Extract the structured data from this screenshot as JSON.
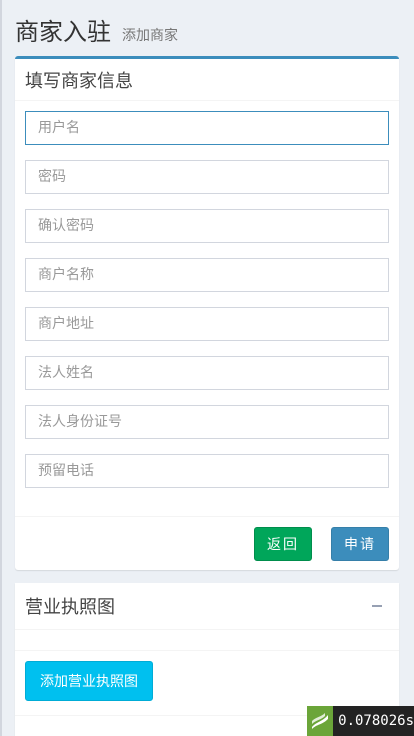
{
  "header": {
    "title": "商家入驻",
    "subtitle": "添加商家"
  },
  "form_box": {
    "title": "填写商家信息",
    "fields": [
      {
        "placeholder": "用户名",
        "value": ""
      },
      {
        "placeholder": "密码",
        "value": ""
      },
      {
        "placeholder": "确认密码",
        "value": ""
      },
      {
        "placeholder": "商户名称",
        "value": ""
      },
      {
        "placeholder": "商户地址",
        "value": ""
      },
      {
        "placeholder": "法人姓名",
        "value": ""
      },
      {
        "placeholder": "法人身份证号",
        "value": ""
      },
      {
        "placeholder": "预留电话",
        "value": ""
      }
    ],
    "back_label": "返回",
    "apply_label": "申请"
  },
  "license_box": {
    "title": "营业执照图",
    "add_button_label": "添加营业执照图"
  },
  "debug_badge": {
    "time": "0.078026s"
  },
  "colors": {
    "primary": "#3c8dbc",
    "success": "#00a65a",
    "info": "#00c0ef",
    "background": "#ecf0f5"
  },
  "icons": {
    "collapse": "minus-icon",
    "debug_logo": "thinkphp-trace-icon"
  }
}
